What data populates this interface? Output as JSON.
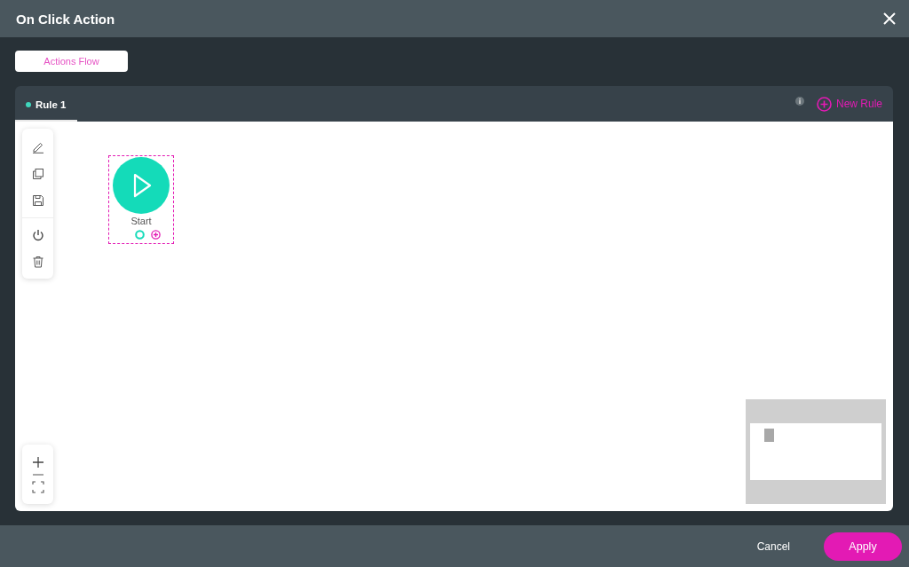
{
  "window": {
    "title": "On Click Action"
  },
  "view_tabs": [
    {
      "label": "Actions Flow",
      "selected": true
    }
  ],
  "rules": [
    {
      "label": "Rule 1",
      "selected": true
    }
  ],
  "new_rule": {
    "label": "New Rule"
  },
  "flow": {
    "nodes": [
      {
        "kind": "start",
        "label": "Start"
      }
    ]
  },
  "buttons": [
    {
      "kind": "secondary",
      "label": "Cancel"
    },
    {
      "kind": "primary",
      "label": "Apply"
    }
  ]
}
